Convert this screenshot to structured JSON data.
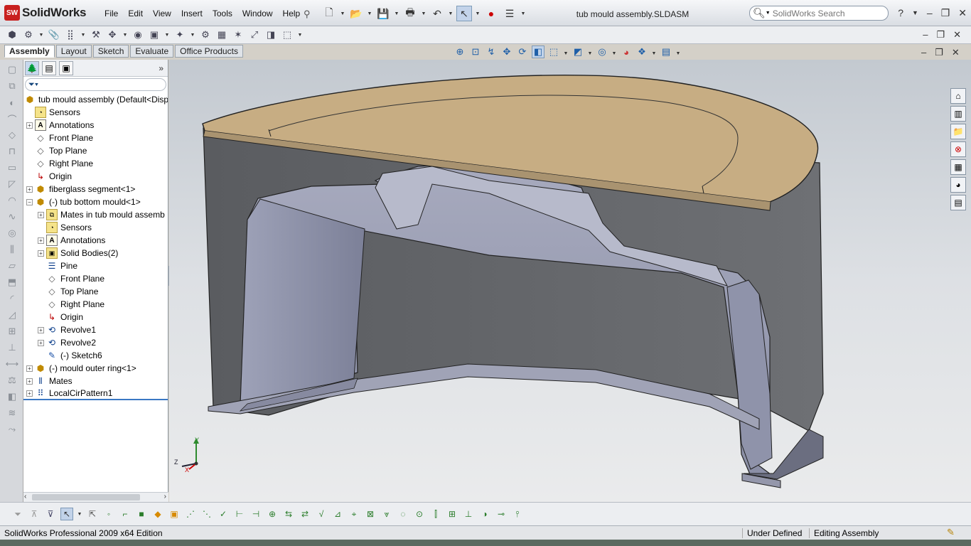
{
  "app": {
    "name": "SolidWorks",
    "logo_text": "SW",
    "document_title": "tub mould assembly.SLDASM"
  },
  "menu": [
    "File",
    "Edit",
    "View",
    "Insert",
    "Tools",
    "Window",
    "Help"
  ],
  "search": {
    "placeholder": "SolidWorks Search"
  },
  "command_tabs": [
    {
      "label": "Assembly",
      "active": true
    },
    {
      "label": "Layout",
      "active": false
    },
    {
      "label": "Sketch",
      "active": false
    },
    {
      "label": "Evaluate",
      "active": false
    },
    {
      "label": "Office Products",
      "active": false
    }
  ],
  "tree": {
    "root": "tub mould assembly  (Default<Disp",
    "items": [
      {
        "label": "Sensors",
        "icon": "sensor-folder-icon",
        "expander": false
      },
      {
        "label": "Annotations",
        "icon": "annotations-icon",
        "expander": true
      },
      {
        "label": "Front Plane",
        "icon": "plane-icon",
        "expander": false
      },
      {
        "label": "Top Plane",
        "icon": "plane-icon",
        "expander": false
      },
      {
        "label": "Right Plane",
        "icon": "plane-icon",
        "expander": false
      },
      {
        "label": "Origin",
        "icon": "origin-icon",
        "expander": false
      },
      {
        "label": "fiberglass segment<1>",
        "icon": "part-icon",
        "expander": true
      },
      {
        "label": "(-) tub bottom mould<1>",
        "icon": "part-icon",
        "expander": "open"
      },
      {
        "label": "Mates in tub mould assemb",
        "icon": "mates-folder-icon",
        "expander": true
      },
      {
        "label": "Sensors",
        "icon": "sensor-folder-icon",
        "expander": false
      },
      {
        "label": "Annotations",
        "icon": "annotations-icon",
        "expander": true
      },
      {
        "label": "Solid Bodies(2)",
        "icon": "solid-bodies-icon",
        "expander": true
      },
      {
        "label": "Pine",
        "icon": "material-icon",
        "expander": false
      },
      {
        "label": "Front Plane",
        "icon": "plane-icon",
        "expander": false
      },
      {
        "label": "Top Plane",
        "icon": "plane-icon",
        "expander": false
      },
      {
        "label": "Right Plane",
        "icon": "plane-icon",
        "expander": false
      },
      {
        "label": "Origin",
        "icon": "origin-icon",
        "expander": false
      },
      {
        "label": "Revolve1",
        "icon": "revolve-icon",
        "expander": true
      },
      {
        "label": "Revolve2",
        "icon": "revolve-icon",
        "expander": true
      },
      {
        "label": "(-) Sketch6",
        "icon": "sketch-icon",
        "expander": false
      },
      {
        "label": "(-) mould outer ring<1>",
        "icon": "part-icon",
        "expander": true
      },
      {
        "label": "Mates",
        "icon": "mates-icon",
        "expander": true
      },
      {
        "label": "LocalCirPattern1",
        "icon": "pattern-icon",
        "expander": true
      }
    ]
  },
  "triad": {
    "x": "X",
    "y": "Y",
    "z": "Z"
  },
  "status": {
    "edition": "SolidWorks Professional 2009 x64 Edition",
    "state": "Under Defined",
    "mode": "Editing Assembly"
  }
}
